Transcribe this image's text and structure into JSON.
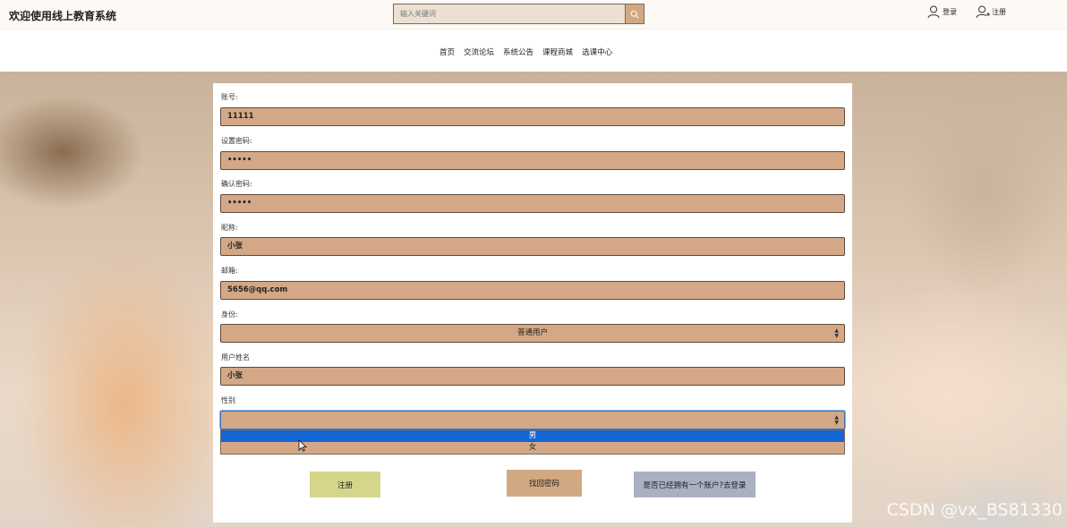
{
  "header": {
    "title": "欢迎使用线上教育系统",
    "search_placeholder": "输入关键词",
    "login_label": "登录",
    "register_label": "注册"
  },
  "nav": {
    "items": [
      "首页",
      "交流论坛",
      "系统公告",
      "课程商城",
      "选课中心"
    ]
  },
  "form": {
    "account": {
      "label": "账号:",
      "value": "11111"
    },
    "password": {
      "label": "设置密码:",
      "value": "•••••"
    },
    "confirm_password": {
      "label": "确认密码:",
      "value": "•••••"
    },
    "nickname": {
      "label": "昵称:",
      "value": "小张"
    },
    "email": {
      "label": "邮箱:",
      "value": "5656@qq.com"
    },
    "identity": {
      "label": "身份:",
      "value": "普通用户"
    },
    "username": {
      "label": "用户姓名",
      "value": "小张"
    },
    "gender": {
      "label": "性别",
      "value": "",
      "options": [
        "男",
        "女"
      ],
      "highlighted": "男"
    }
  },
  "buttons": {
    "register": "注册",
    "recover_password": "找回密码",
    "go_login": "是否已经拥有一个账户?去登录"
  },
  "colors": {
    "field_bg": "#d4a886",
    "register_btn": "#d6d68a",
    "recover_btn": "#d2a883",
    "login_btn": "#a8b0c2",
    "option_highlight": "#1466d6"
  },
  "watermark": "CSDN @vx_BS81330"
}
